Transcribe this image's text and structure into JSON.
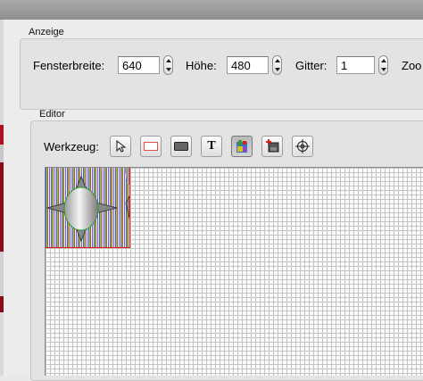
{
  "colors": {
    "selection_border": "#e01010",
    "window_bg": "#ececec"
  },
  "anzeige": {
    "title": "Anzeige",
    "fensterbreite_label": "Fensterbreite:",
    "fensterbreite_value": "640",
    "hoehe_label": "Höhe:",
    "hoehe_value": "480",
    "gitter_label": "Gitter:",
    "gitter_value": "1",
    "zoom_label": "Zoo"
  },
  "editor": {
    "title": "Editor",
    "werkzeug_label": "Werkzeug:",
    "tools": [
      {
        "name": "select-arrow-icon"
      },
      {
        "name": "rectangle-outline-icon"
      },
      {
        "name": "filled-rectangle-icon"
      },
      {
        "name": "text-tool-icon",
        "glyph": "T"
      },
      {
        "name": "sprite-tool-icon",
        "active": true
      },
      {
        "name": "image-insert-icon"
      },
      {
        "name": "crosshair-icon"
      }
    ]
  }
}
